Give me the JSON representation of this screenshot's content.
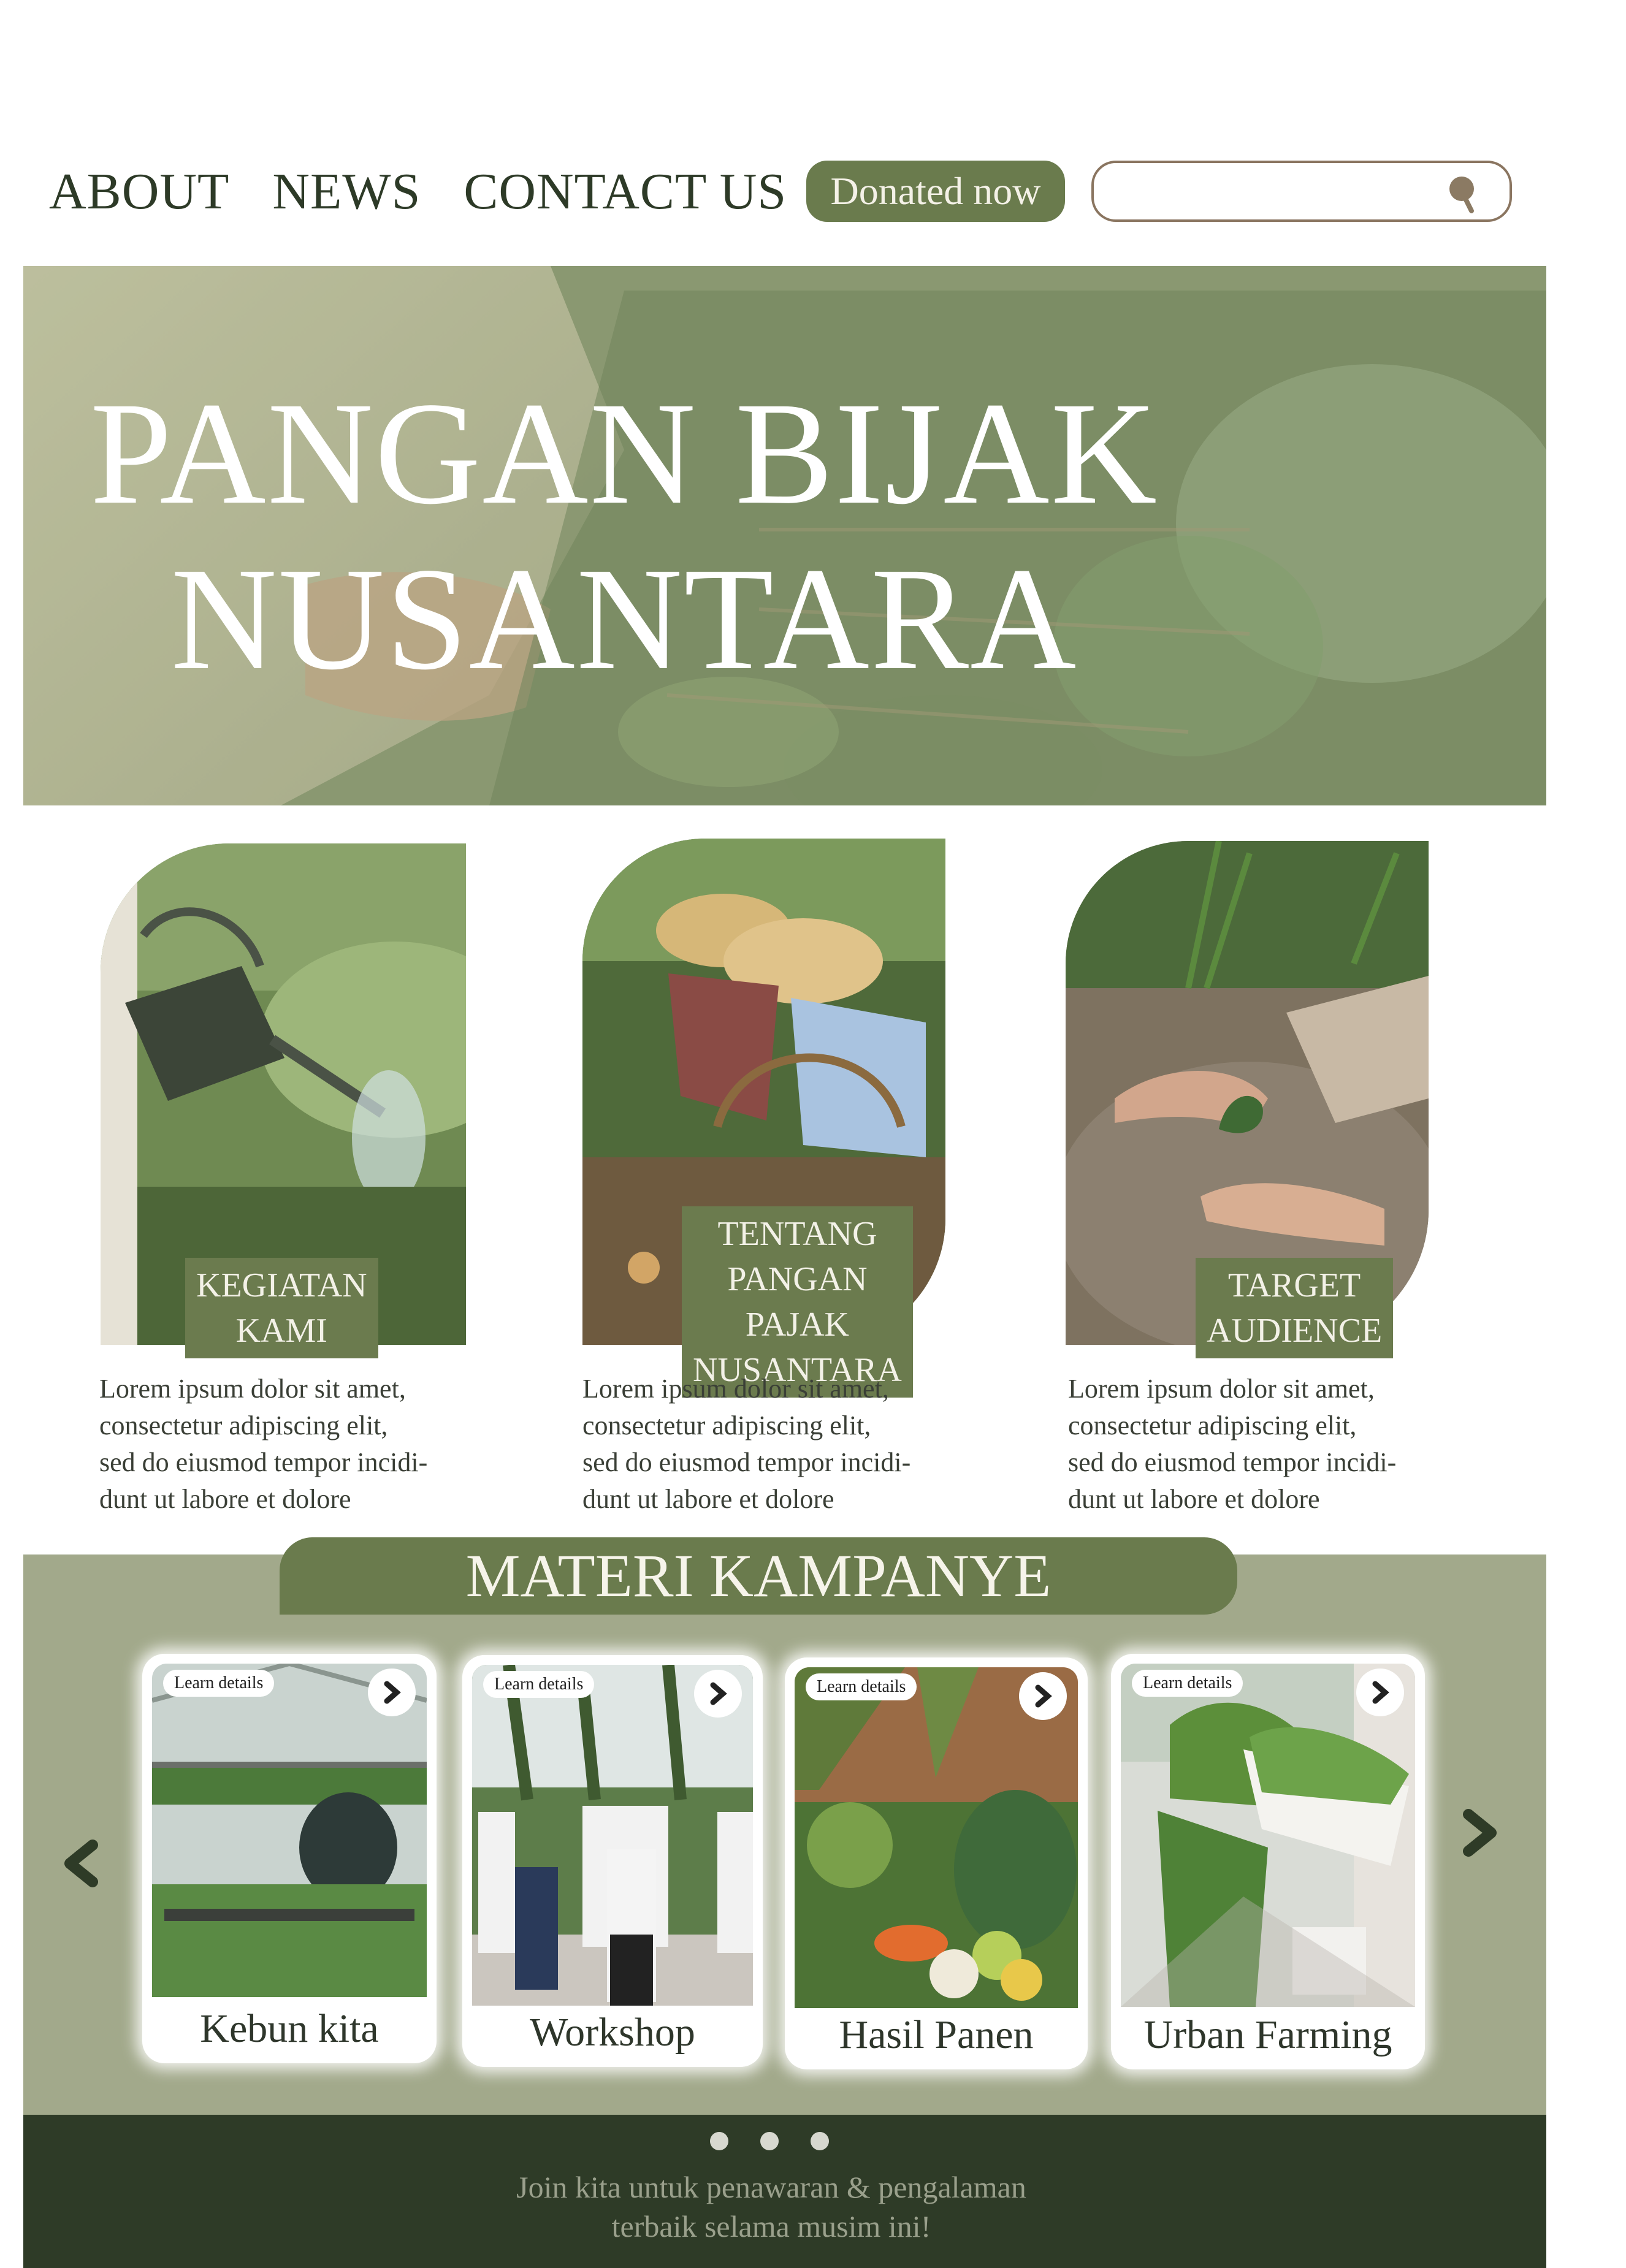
{
  "nav": {
    "items": [
      "ABOUT",
      "NEWS",
      "CONTACT US"
    ],
    "donate_label": "Donated now",
    "search_placeholder": "",
    "search_icon": "search-icon"
  },
  "hero": {
    "title_line1": "PANGAN BIJAK",
    "title_line2": "NUSANTARA"
  },
  "features": [
    {
      "tag_lines": [
        "KEGIATAN KAMI"
      ],
      "image": "watering-can-garden-photo",
      "desc_lines": [
        "Lorem ipsum dolor sit amet,",
        "consectetur adipiscing elit,",
        "sed do eiusmod tempor incidi-",
        "dunt ut labore et dolore"
      ]
    },
    {
      "tag_lines": [
        "TENTANG PANGAN",
        "PAJAK NUSANTARA"
      ],
      "image": "harvest-basket-photo",
      "desc_lines": [
        "Lorem ipsum dolor sit amet,",
        "consectetur adipiscing elit,",
        "sed do eiusmod tempor incidi-",
        "dunt ut labore et dolore"
      ]
    },
    {
      "tag_lines": [
        "TARGET AUDIENCE"
      ],
      "image": "planting-seedling-photo",
      "desc_lines": [
        "Lorem ipsum dolor sit amet,",
        "consectetur adipiscing elit,",
        "sed do eiusmod tempor incidi-",
        "dunt ut labore et dolore"
      ]
    }
  ],
  "campaign": {
    "title": "MATERI KAMPANYE",
    "cards": [
      {
        "pill": "Learn details",
        "label": "Kebun kita"
      },
      {
        "pill": "Learn details",
        "label": "Workshop"
      },
      {
        "pill": "Learn details",
        "label": "Hasil Panen"
      },
      {
        "pill": "Learn details",
        "label": "Urban Farming"
      }
    ]
  },
  "footer": {
    "line1": "Join kita untuk penawaran & pengalaman",
    "line2": "terbaik selama musim ini!",
    "page_count": 3
  },
  "colors": {
    "accent": "#6a7b4d",
    "campaign_bg": "#a2a98b",
    "footer_bg": "#2e3b27",
    "nav_text": "#2d3a27"
  }
}
